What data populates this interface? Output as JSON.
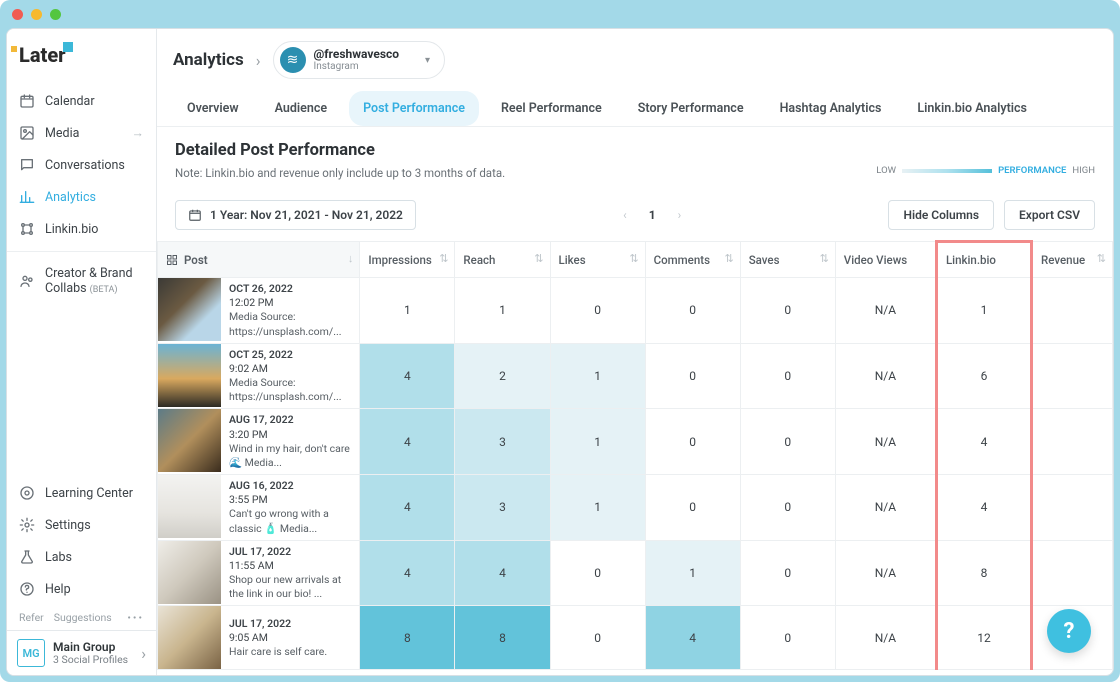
{
  "traffic_lights": [
    "#f15b52",
    "#f7b92e",
    "#54c63f"
  ],
  "logo_text": "Later",
  "sidebar": {
    "items": [
      {
        "label": "Calendar",
        "icon": "calendar"
      },
      {
        "label": "Media",
        "icon": "media",
        "arrow": true
      },
      {
        "label": "Conversations",
        "icon": "chat"
      },
      {
        "label": "Analytics",
        "icon": "analytics",
        "active": true
      },
      {
        "label": "Linkin.bio",
        "icon": "link"
      },
      {
        "label": "Creator & Brand Collabs",
        "icon": "collab",
        "beta": "(BETA)"
      }
    ],
    "bottom": [
      {
        "label": "Learning Center",
        "icon": "learn"
      },
      {
        "label": "Settings",
        "icon": "gear"
      },
      {
        "label": "Labs",
        "icon": "flask"
      },
      {
        "label": "Help",
        "icon": "help"
      }
    ],
    "refer": "Refer",
    "suggestions": "Suggestions",
    "profile": {
      "initials": "MG",
      "name": "Main Group",
      "sub": "3 Social Profiles"
    }
  },
  "header": {
    "crumb": "Analytics",
    "account": {
      "handle": "@freshwavesco",
      "platform": "Instagram"
    }
  },
  "tabs": [
    "Overview",
    "Audience",
    "Post Performance",
    "Reel Performance",
    "Story Performance",
    "Hashtag Analytics",
    "Linkin.bio Analytics"
  ],
  "active_tab": 2,
  "section": {
    "title": "Detailed Post Performance",
    "note": "Note: Linkin.bio and revenue only include up to 3 months of data."
  },
  "legend": {
    "low": "LOW",
    "label": "PERFORMANCE",
    "high": "HIGH"
  },
  "controls": {
    "date_range": "1 Year: Nov 21, 2021 - Nov 21, 2022",
    "page": "1",
    "hide": "Hide Columns",
    "export": "Export CSV"
  },
  "columns": [
    "Post",
    "Impressions",
    "Reach",
    "Likes",
    "Comments",
    "Saves",
    "Video Views",
    "Linkin.bio",
    "Revenue"
  ],
  "highlight_column_index": 7,
  "rows": [
    {
      "date": "OCT 26, 2022",
      "time": "12:02 PM",
      "desc": "Media Source: https://unsplash.com/...",
      "thumb": "linear-gradient(135deg,#3b3a36 0%,#6b5a42 40%,#b9d6e8 70%)",
      "cells": [
        {
          "v": "1",
          "h": 0
        },
        {
          "v": "1",
          "h": 0
        },
        {
          "v": "0",
          "h": 0
        },
        {
          "v": "0",
          "h": 0
        },
        {
          "v": "0",
          "h": 0
        },
        {
          "v": "N/A",
          "h": 0
        },
        {
          "v": "1",
          "h": 0
        },
        {
          "v": "",
          "h": 0
        }
      ]
    },
    {
      "date": "OCT 25, 2022",
      "time": "9:02 AM",
      "desc": "Media Source: https://unsplash.com/...",
      "thumb": "linear-gradient(180deg,#6bb3d4 0%,#d9a95f 55%,#2c2a24 100%)",
      "cells": [
        {
          "v": "4",
          "h": 3
        },
        {
          "v": "2",
          "h": 1
        },
        {
          "v": "1",
          "h": 1
        },
        {
          "v": "0",
          "h": 0
        },
        {
          "v": "0",
          "h": 0
        },
        {
          "v": "N/A",
          "h": 0
        },
        {
          "v": "6",
          "h": 0
        },
        {
          "v": "",
          "h": 0
        }
      ]
    },
    {
      "date": "AUG 17, 2022",
      "time": "3:20 PM",
      "desc": "Wind in my hair, don't care 🌊   Media...",
      "thumb": "linear-gradient(135deg,#5c7b87 0%,#b18f5c 50%,#3a2c1d 100%)",
      "cells": [
        {
          "v": "4",
          "h": 3
        },
        {
          "v": "3",
          "h": 2
        },
        {
          "v": "1",
          "h": 1
        },
        {
          "v": "0",
          "h": 0
        },
        {
          "v": "0",
          "h": 0
        },
        {
          "v": "N/A",
          "h": 0
        },
        {
          "v": "4",
          "h": 0
        },
        {
          "v": "",
          "h": 0
        }
      ]
    },
    {
      "date": "AUG 16, 2022",
      "time": "3:55 PM",
      "desc": "Can't go wrong with a classic 🧴   Media...",
      "thumb": "linear-gradient(180deg,#f3f3f1 0%,#e6e4df 60%,#d0cec8 100%)",
      "cells": [
        {
          "v": "4",
          "h": 3
        },
        {
          "v": "3",
          "h": 2
        },
        {
          "v": "1",
          "h": 1
        },
        {
          "v": "0",
          "h": 0
        },
        {
          "v": "0",
          "h": 0
        },
        {
          "v": "N/A",
          "h": 0
        },
        {
          "v": "4",
          "h": 0
        },
        {
          "v": "",
          "h": 0
        }
      ]
    },
    {
      "date": "JUL 17, 2022",
      "time": "11:55 AM",
      "desc": "Shop our new arrivals at the link in our bio!  ...",
      "thumb": "linear-gradient(135deg,#efede8 0%,#cfc9bd 50%,#9a9284 100%)",
      "cells": [
        {
          "v": "4",
          "h": 3
        },
        {
          "v": "4",
          "h": 3
        },
        {
          "v": "0",
          "h": 0
        },
        {
          "v": "1",
          "h": 1
        },
        {
          "v": "0",
          "h": 0
        },
        {
          "v": "N/A",
          "h": 0
        },
        {
          "v": "8",
          "h": 0
        },
        {
          "v": "",
          "h": 0
        }
      ]
    },
    {
      "date": "JUL 17, 2022",
      "time": "9:05 AM",
      "desc": "Hair care is self care.",
      "thumb": "linear-gradient(135deg,#e9e3d6 0%,#c9b58e 50%,#7a6345 100%)",
      "cells": [
        {
          "v": "8",
          "h": 5
        },
        {
          "v": "8",
          "h": 5
        },
        {
          "v": "0",
          "h": 0
        },
        {
          "v": "4",
          "h": 4
        },
        {
          "v": "0",
          "h": 0
        },
        {
          "v": "N/A",
          "h": 0
        },
        {
          "v": "12",
          "h": 0
        },
        {
          "v": "",
          "h": 0
        }
      ]
    }
  ],
  "chart_data": {
    "type": "heatmap",
    "title": "Detailed Post Performance",
    "note": "Cell background shade encodes performance (LOW → HIGH)",
    "columns": [
      "Impressions",
      "Reach",
      "Likes",
      "Comments",
      "Saves",
      "Video Views",
      "Linkin.bio",
      "Revenue"
    ],
    "row_labels": [
      "OCT 26, 2022 12:02 PM",
      "OCT 25, 2022 9:02 AM",
      "AUG 17, 2022 3:20 PM",
      "AUG 16, 2022 3:55 PM",
      "JUL 17, 2022 11:55 AM",
      "JUL 17, 2022 9:05 AM"
    ],
    "values": [
      [
        1,
        1,
        0,
        0,
        0,
        "N/A",
        1,
        null
      ],
      [
        4,
        2,
        1,
        0,
        0,
        "N/A",
        6,
        null
      ],
      [
        4,
        3,
        1,
        0,
        0,
        "N/A",
        4,
        null
      ],
      [
        4,
        3,
        1,
        0,
        0,
        "N/A",
        4,
        null
      ],
      [
        4,
        4,
        0,
        1,
        0,
        "N/A",
        8,
        null
      ],
      [
        8,
        8,
        0,
        4,
        0,
        "N/A",
        12,
        null
      ]
    ],
    "heat_levels": [
      [
        0,
        0,
        0,
        0,
        0,
        0,
        0,
        0
      ],
      [
        3,
        1,
        1,
        0,
        0,
        0,
        0,
        0
      ],
      [
        3,
        2,
        1,
        0,
        0,
        0,
        0,
        0
      ],
      [
        3,
        2,
        1,
        0,
        0,
        0,
        0,
        0
      ],
      [
        3,
        3,
        0,
        1,
        0,
        0,
        0,
        0
      ],
      [
        5,
        5,
        0,
        4,
        0,
        0,
        0,
        0
      ]
    ]
  }
}
